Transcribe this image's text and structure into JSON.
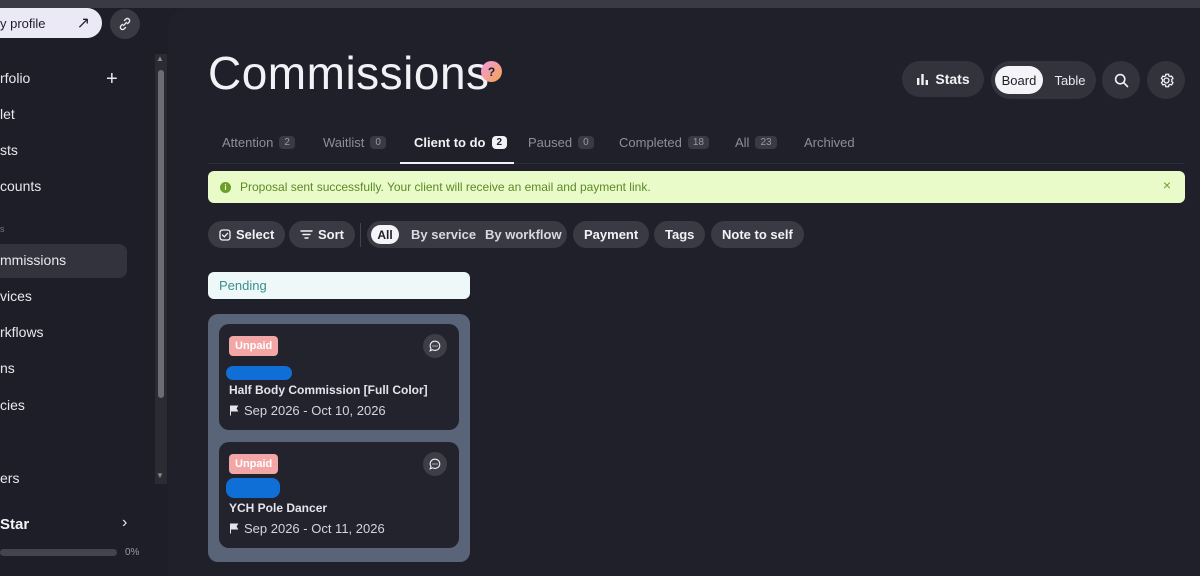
{
  "sidebar": {
    "profile_label": "y profile",
    "items": [
      {
        "label": "rfolio"
      },
      {
        "label": "let"
      },
      {
        "label": "sts"
      },
      {
        "label": "counts"
      },
      {
        "label": "mmissions"
      },
      {
        "label": "vices"
      },
      {
        "label": "rkflows"
      },
      {
        "label": "ns"
      },
      {
        "label": "cies"
      },
      {
        "label": "ers"
      }
    ],
    "section_label": "s",
    "star_label": "Star",
    "progress": {
      "value": 0,
      "label": "0%"
    }
  },
  "header": {
    "title": "Commissions",
    "help_glyph": "?",
    "stats_label": "Stats",
    "view_toggle": {
      "active": "Board",
      "inactive": "Table"
    }
  },
  "tabs": [
    {
      "label": "Attention",
      "count": "2"
    },
    {
      "label": "Waitlist",
      "count": "0"
    },
    {
      "label": "Client to do",
      "count": "2",
      "active": true
    },
    {
      "label": "Paused",
      "count": "0"
    },
    {
      "label": "Completed",
      "count": "18"
    },
    {
      "label": "All",
      "count": "23"
    },
    {
      "label": "Archived",
      "count": ""
    }
  ],
  "alert": {
    "message": "Proposal sent successfully. Your client will receive an email and payment link.",
    "close": "×"
  },
  "toolbar": {
    "select_label": "Select",
    "sort_label": "Sort",
    "group_all": "All",
    "group_service": "By service",
    "group_workflow": "By workflow",
    "payment_label": "Payment",
    "tags_label": "Tags",
    "note_label": "Note to self"
  },
  "board": {
    "column_title": "Pending",
    "cards": [
      {
        "badge": "Unpaid",
        "title": "Half Body Commission [Full Color]",
        "dates": "Sep 2026 - Oct 10, 2026"
      },
      {
        "badge": "Unpaid",
        "title": "YCH Pole Dancer",
        "dates": "Sep 2026 - Oct 11, 2026"
      }
    ]
  },
  "colors": {
    "accent_green": "#e9fbc8",
    "badge_unpaid": "#f3a6a6",
    "column": "#5a6478"
  }
}
